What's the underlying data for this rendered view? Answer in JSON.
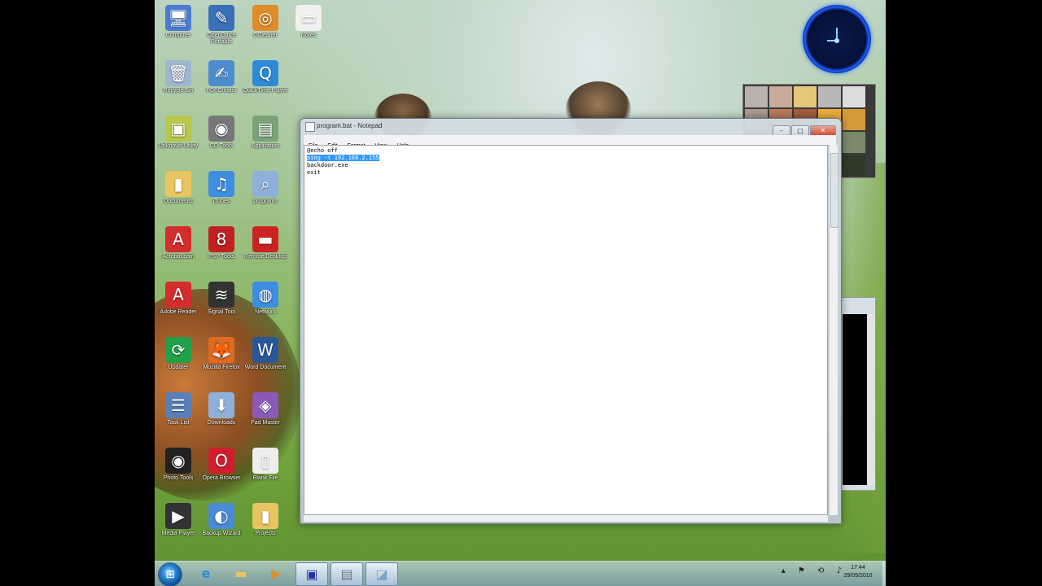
{
  "desktop": {
    "icons": [
      {
        "label": "Computer",
        "glyph": "🖥",
        "color": "#4a7bd0"
      },
      {
        "label": "OpenOffice Portable",
        "glyph": "✎",
        "color": "#3b6fb6"
      },
      {
        "label": "CCleaner",
        "glyph": "◎",
        "color": "#e08c2a"
      },
      {
        "label": "Notes",
        "glyph": "▭",
        "color": "#f1f1f1"
      },
      {
        "label": "Recycle Bin",
        "glyph": "🗑",
        "color": "#9fb6cf"
      },
      {
        "label": "PDFCreator",
        "glyph": "✍",
        "color": "#4c8ccf"
      },
      {
        "label": "QuickTime Player",
        "glyph": "Q",
        "color": "#2d8ad6"
      },
      {
        "label": "Unknown Utility",
        "glyph": "▣",
        "color": "#b8c84a"
      },
      {
        "label": "CD Tools",
        "glyph": "◉",
        "color": "#777777"
      },
      {
        "label": "Application",
        "glyph": "▤",
        "color": "#7aa37a"
      },
      {
        "label": "Documents",
        "glyph": "▮",
        "color": "#e8c560"
      },
      {
        "label": "iTunes",
        "glyph": "♫",
        "color": "#3d8de0"
      },
      {
        "label": "programs",
        "glyph": "⌕",
        "color": "#8fb0d8"
      },
      {
        "label": "Acrobat.com",
        "glyph": "A",
        "color": "#d32d2d"
      },
      {
        "label": "PSP Tools",
        "glyph": "8",
        "color": "#c02020"
      },
      {
        "label": "Remote Desktop",
        "glyph": "▬",
        "color": "#cc2222"
      },
      {
        "label": "Adobe Reader",
        "glyph": "A",
        "color": "#d32d2d"
      },
      {
        "label": "Signal Tool",
        "glyph": "≋",
        "color": "#333333"
      },
      {
        "label": "Network",
        "glyph": "◍",
        "color": "#3d8de0"
      },
      {
        "label": "Updater",
        "glyph": "⟳",
        "color": "#22a04a"
      },
      {
        "label": "Mozilla Firefox",
        "glyph": "🦊",
        "color": "#e06a1e"
      },
      {
        "label": "Word Document",
        "glyph": "W",
        "color": "#2b579a"
      },
      {
        "label": "Task List",
        "glyph": "☰",
        "color": "#5a7fb8"
      },
      {
        "label": "Downloads",
        "glyph": "⬇",
        "color": "#8fb0d8"
      },
      {
        "label": "Pad Master",
        "glyph": "◈",
        "color": "#8a5ab8"
      },
      {
        "label": "Photo Tools",
        "glyph": "◉",
        "color": "#222222"
      },
      {
        "label": "Opera Browser",
        "glyph": "O",
        "color": "#d01e2f"
      },
      {
        "label": "Blank File",
        "glyph": "▯",
        "color": "#eeeeee"
      },
      {
        "label": "Media Player",
        "glyph": "▶",
        "color": "#333333"
      },
      {
        "label": "Backup Wizard",
        "glyph": "◐",
        "color": "#4a8ad6"
      },
      {
        "label": "Projects",
        "glyph": "▮",
        "color": "#e8c560"
      }
    ]
  },
  "notepad": {
    "title": "program.bat - Notepad",
    "menu": [
      "File",
      "Edit",
      "Format",
      "View",
      "Help"
    ],
    "lines": {
      "line1": "@echo off",
      "line2_selected": "ping -t 192.168.2.155",
      "line3": "backdoor.exe",
      "line4": "exit"
    },
    "controls": {
      "minimize": "–",
      "maximize": "□",
      "close": "✕"
    }
  },
  "taskbar": {
    "start_glyph": "⊞",
    "buttons": [
      {
        "name": "ie",
        "glyph": "e",
        "color": "#2d8ad6"
      },
      {
        "name": "explorer",
        "glyph": "▬",
        "color": "#e8c560"
      },
      {
        "name": "media-player",
        "glyph": "▶",
        "color": "#e08c2a"
      },
      {
        "name": "cmd",
        "glyph": "▣",
        "color": "#2233aa"
      },
      {
        "name": "notepad",
        "glyph": "▤",
        "color": "#6a7a8a"
      },
      {
        "name": "app",
        "glyph": "◪",
        "color": "#7aa3c6"
      }
    ],
    "tray_icons": "▴ ⚑ ⟲ ♪",
    "time": "17:44",
    "date": "29/05/2010"
  },
  "gadgets": {
    "clock": {
      "label": "clock-gadget"
    }
  },
  "colors": {
    "selection": "#3399ff",
    "close_button": "#c74a2e"
  }
}
